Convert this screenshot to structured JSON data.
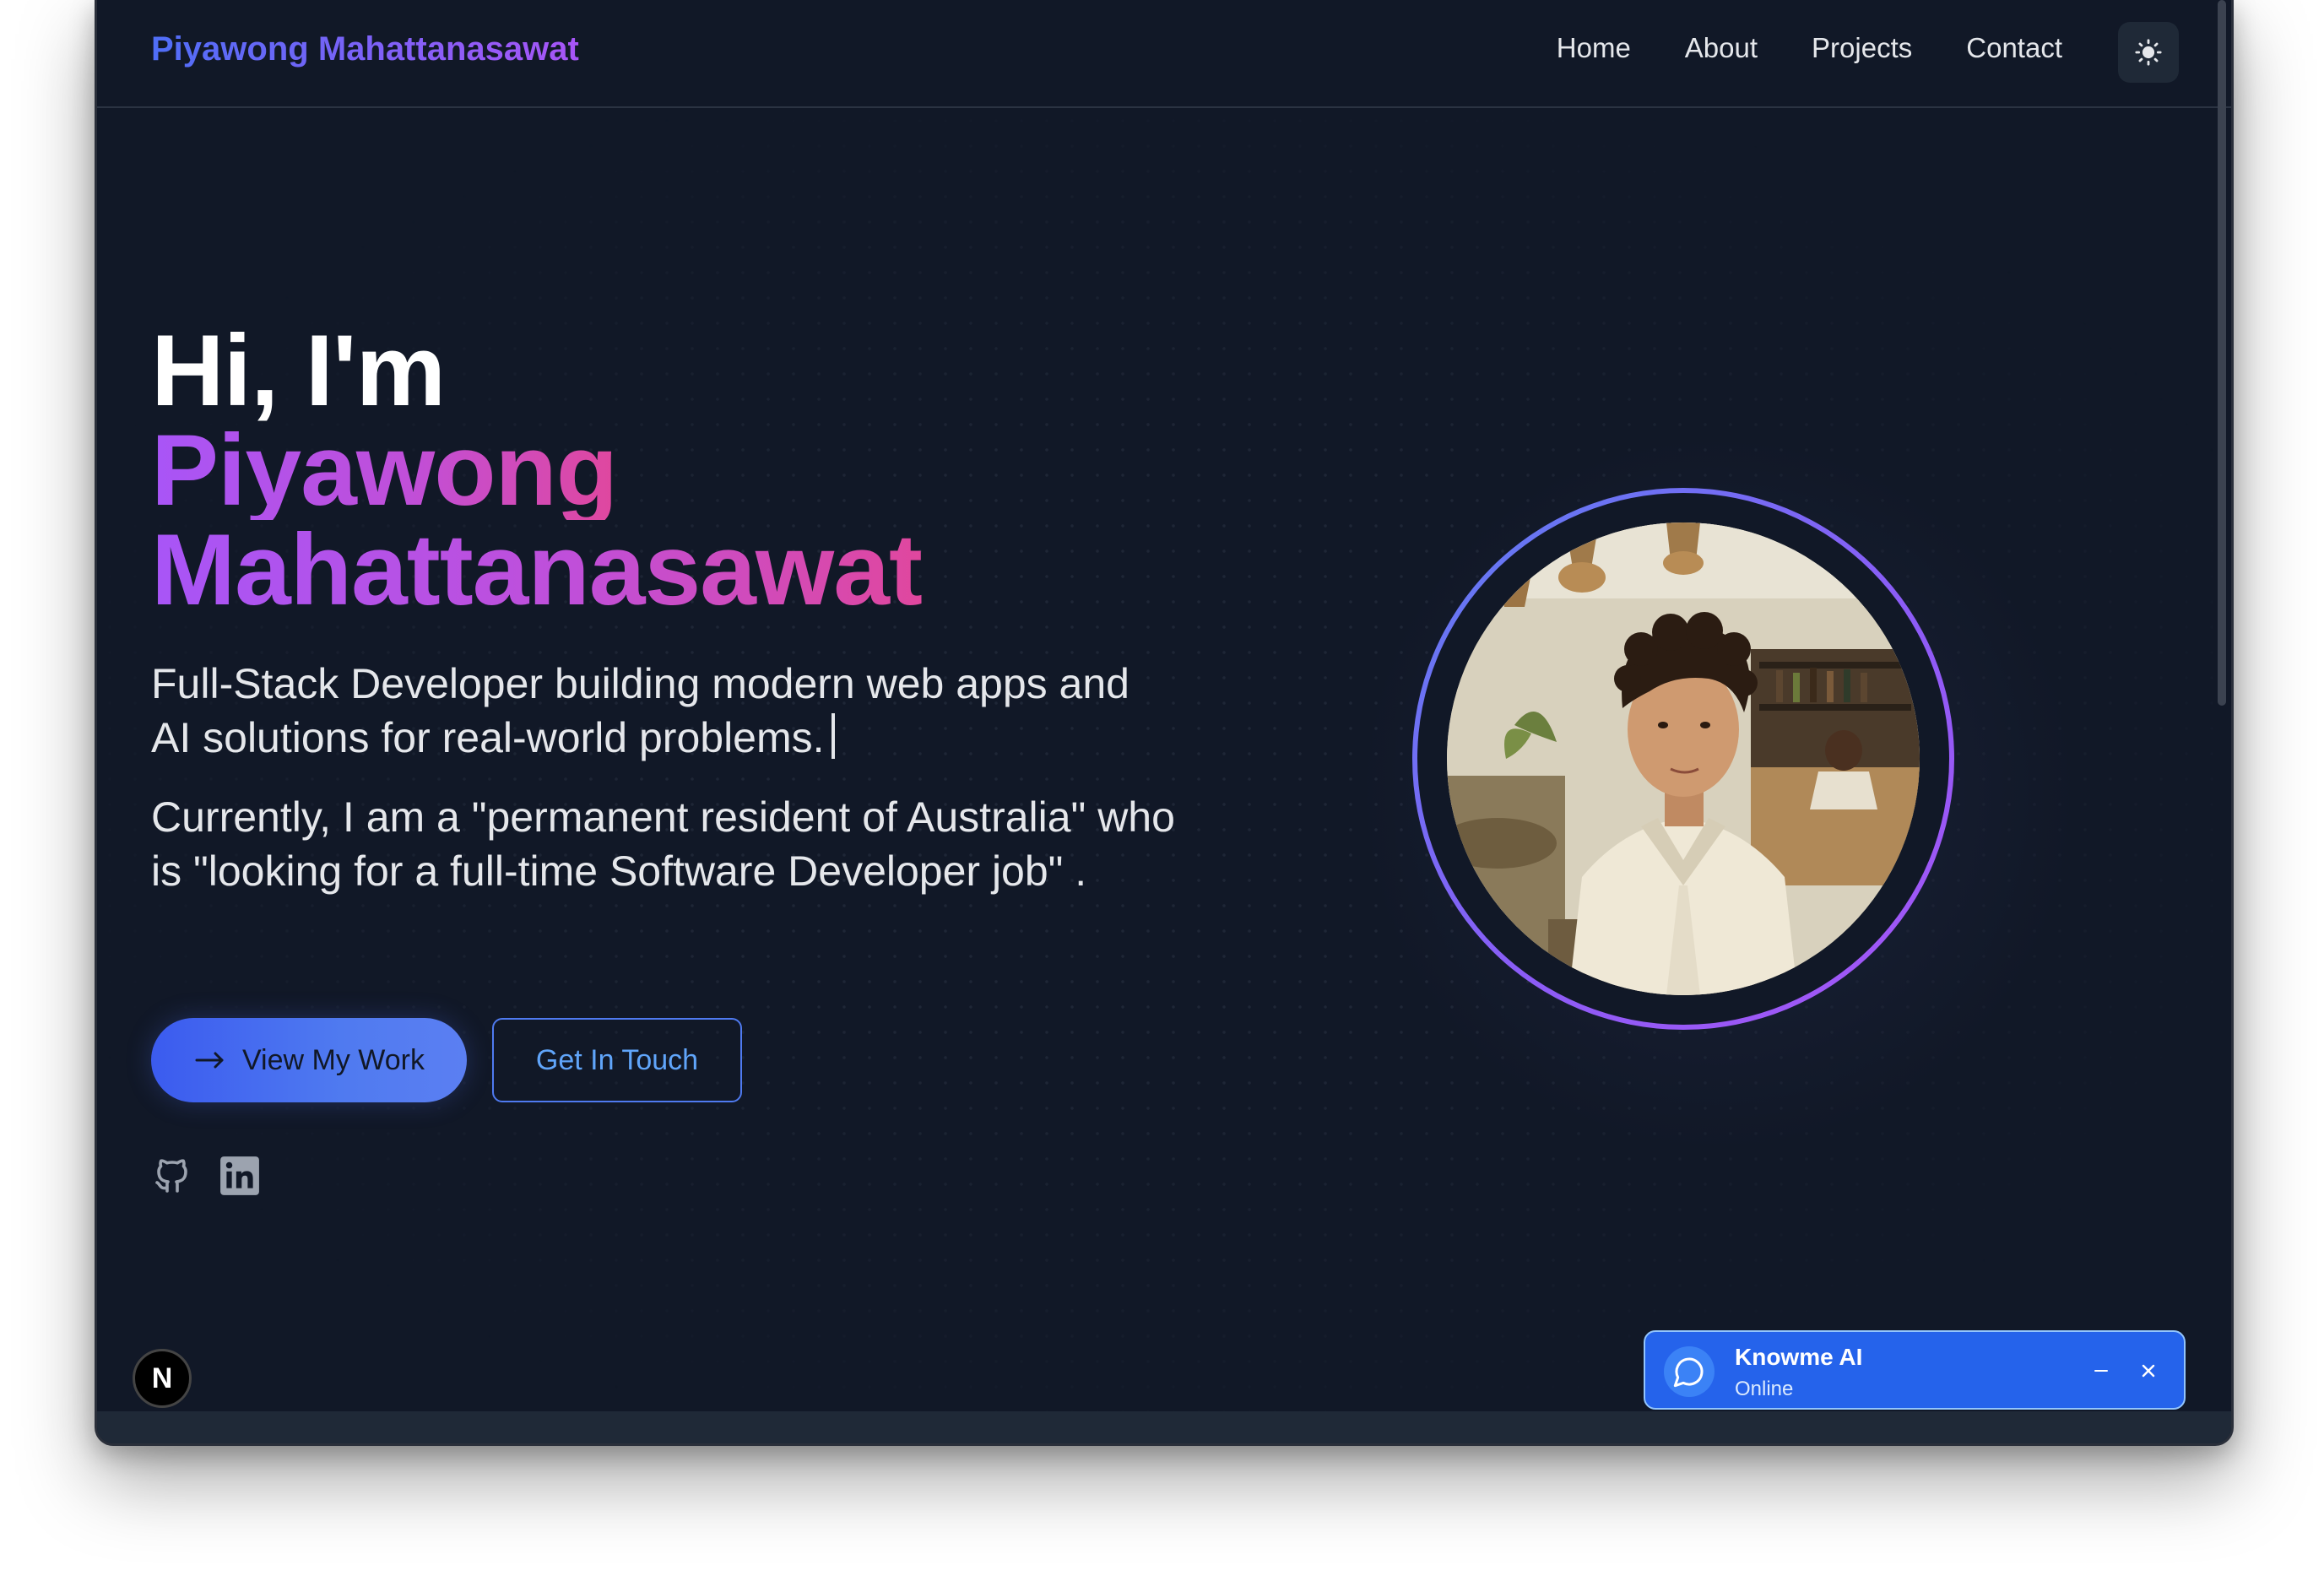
{
  "nav": {
    "brand": "Piyawong Mahattanasawat",
    "links": [
      "Home",
      "About",
      "Projects",
      "Contact"
    ],
    "theme_toggle_icon": "sun-icon"
  },
  "hero": {
    "greeting": "Hi, I'm",
    "name_line1": "Piyawong",
    "name_line2": "Mahattanasawat",
    "subtitle": "Full-Stack Developer building modern web apps and AI solutions for real-world problems.",
    "status": "Currently, I am a \"permanent resident of Australia\" who is \"looking for a full-time Software Developer job\" .",
    "primary_button": "View My Work",
    "secondary_button": "Get In Touch",
    "socials": [
      "github-icon",
      "linkedin-icon"
    ]
  },
  "portrait": {
    "ring_gradient": [
      "#5b7ff2",
      "#a855f7"
    ]
  },
  "dev_badge": {
    "label": "N"
  },
  "chat": {
    "title": "Knowme AI",
    "status": "Online",
    "icon": "chat-bubble-icon"
  },
  "colors": {
    "background": "#111827",
    "brand_gradient": [
      "#4f6ef7",
      "#a855f7"
    ],
    "name_gradient": [
      "#a855f7",
      "#e0479e"
    ],
    "primary_button": "#3b5bef",
    "chat_widget": "#2563eb"
  }
}
